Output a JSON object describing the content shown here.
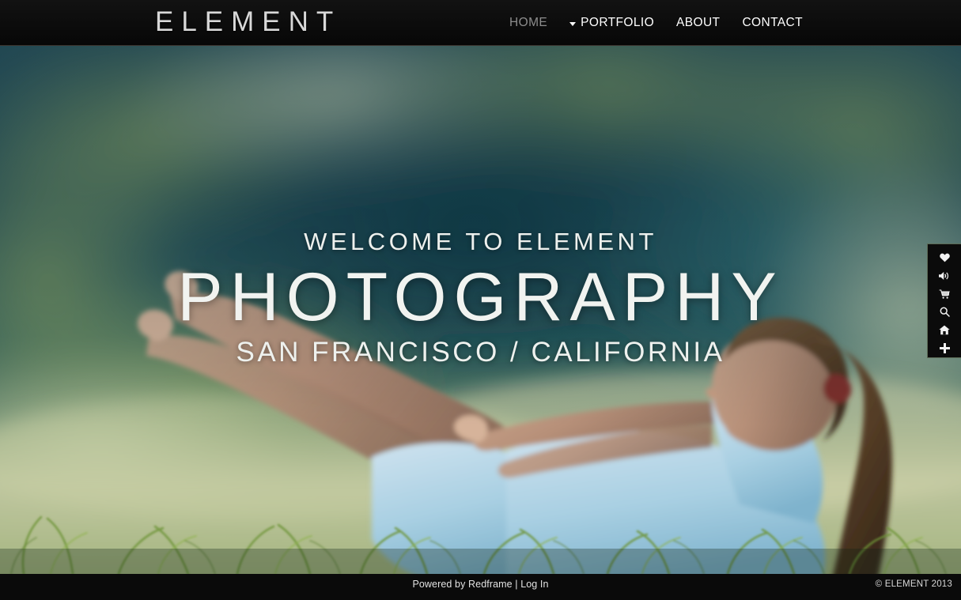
{
  "site": {
    "logo": "ELEMENT"
  },
  "nav": {
    "items": [
      {
        "label": "HOME",
        "state": "dimmed",
        "has_caret": false
      },
      {
        "label": "PORTFOLIO",
        "state": "active",
        "has_caret": true
      },
      {
        "label": "ABOUT",
        "state": "normal",
        "has_caret": false
      },
      {
        "label": "CONTACT",
        "state": "normal",
        "has_caret": false
      }
    ]
  },
  "hero": {
    "line1": "WELCOME TO ELEMENT",
    "line2": "PHOTOGRAPHY",
    "line3": "SAN FRANCISCO / CALIFORNIA",
    "background_description": "Blurred outdoor photo: woman in light blue top doing a boat pose on grass, green foliage backdrop"
  },
  "toolbar": {
    "items": [
      {
        "icon": "heart-icon",
        "label": "Favorites"
      },
      {
        "icon": "speaker-icon",
        "label": "Sound"
      },
      {
        "icon": "cart-icon",
        "label": "Cart"
      },
      {
        "icon": "search-icon",
        "label": "Search"
      },
      {
        "icon": "home-icon",
        "label": "Home"
      },
      {
        "icon": "plus-icon",
        "label": "Add"
      }
    ]
  },
  "footer": {
    "powered_by": "Powered by Redframe",
    "separator": " | ",
    "login": "Log In",
    "copyright": "© ELEMENT 2013"
  },
  "colors": {
    "header_bg": "#0d0d0d",
    "header_border": "#3b332e",
    "nav_active": "#ffffff",
    "nav_dim": "#8d8d8d",
    "hero_text": "#f1f3f0",
    "toolbar_bg": "#0b0b0b",
    "toolbar_border": "#5b6a55",
    "footer_bg": "#0a0a0a",
    "footer_text": "#e2e2e2"
  }
}
